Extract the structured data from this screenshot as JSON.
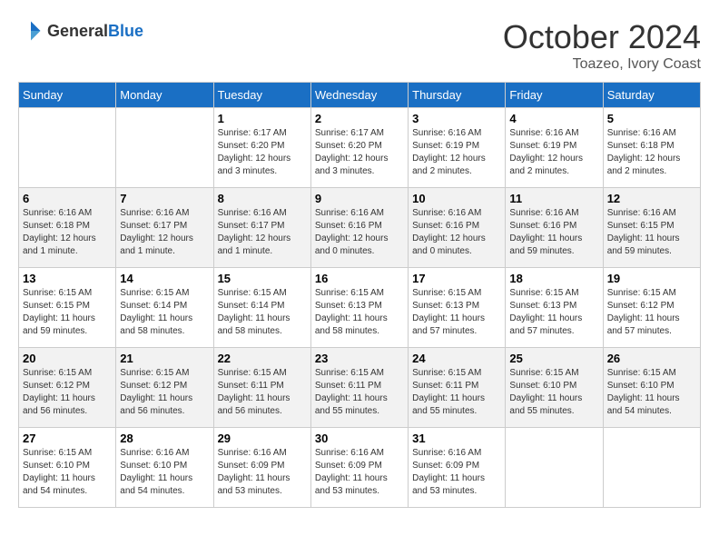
{
  "logo": {
    "text_general": "General",
    "text_blue": "Blue"
  },
  "title": "October 2024",
  "subtitle": "Toazeo, Ivory Coast",
  "days_of_week": [
    "Sunday",
    "Monday",
    "Tuesday",
    "Wednesday",
    "Thursday",
    "Friday",
    "Saturday"
  ],
  "weeks": [
    [
      {
        "day": "",
        "sunrise": "",
        "sunset": "",
        "daylight": ""
      },
      {
        "day": "",
        "sunrise": "",
        "sunset": "",
        "daylight": ""
      },
      {
        "day": "1",
        "sunrise": "Sunrise: 6:17 AM",
        "sunset": "Sunset: 6:20 PM",
        "daylight": "Daylight: 12 hours and 3 minutes."
      },
      {
        "day": "2",
        "sunrise": "Sunrise: 6:17 AM",
        "sunset": "Sunset: 6:20 PM",
        "daylight": "Daylight: 12 hours and 3 minutes."
      },
      {
        "day": "3",
        "sunrise": "Sunrise: 6:16 AM",
        "sunset": "Sunset: 6:19 PM",
        "daylight": "Daylight: 12 hours and 2 minutes."
      },
      {
        "day": "4",
        "sunrise": "Sunrise: 6:16 AM",
        "sunset": "Sunset: 6:19 PM",
        "daylight": "Daylight: 12 hours and 2 minutes."
      },
      {
        "day": "5",
        "sunrise": "Sunrise: 6:16 AM",
        "sunset": "Sunset: 6:18 PM",
        "daylight": "Daylight: 12 hours and 2 minutes."
      }
    ],
    [
      {
        "day": "6",
        "sunrise": "Sunrise: 6:16 AM",
        "sunset": "Sunset: 6:18 PM",
        "daylight": "Daylight: 12 hours and 1 minute."
      },
      {
        "day": "7",
        "sunrise": "Sunrise: 6:16 AM",
        "sunset": "Sunset: 6:17 PM",
        "daylight": "Daylight: 12 hours and 1 minute."
      },
      {
        "day": "8",
        "sunrise": "Sunrise: 6:16 AM",
        "sunset": "Sunset: 6:17 PM",
        "daylight": "Daylight: 12 hours and 1 minute."
      },
      {
        "day": "9",
        "sunrise": "Sunrise: 6:16 AM",
        "sunset": "Sunset: 6:16 PM",
        "daylight": "Daylight: 12 hours and 0 minutes."
      },
      {
        "day": "10",
        "sunrise": "Sunrise: 6:16 AM",
        "sunset": "Sunset: 6:16 PM",
        "daylight": "Daylight: 12 hours and 0 minutes."
      },
      {
        "day": "11",
        "sunrise": "Sunrise: 6:16 AM",
        "sunset": "Sunset: 6:16 PM",
        "daylight": "Daylight: 11 hours and 59 minutes."
      },
      {
        "day": "12",
        "sunrise": "Sunrise: 6:16 AM",
        "sunset": "Sunset: 6:15 PM",
        "daylight": "Daylight: 11 hours and 59 minutes."
      }
    ],
    [
      {
        "day": "13",
        "sunrise": "Sunrise: 6:15 AM",
        "sunset": "Sunset: 6:15 PM",
        "daylight": "Daylight: 11 hours and 59 minutes."
      },
      {
        "day": "14",
        "sunrise": "Sunrise: 6:15 AM",
        "sunset": "Sunset: 6:14 PM",
        "daylight": "Daylight: 11 hours and 58 minutes."
      },
      {
        "day": "15",
        "sunrise": "Sunrise: 6:15 AM",
        "sunset": "Sunset: 6:14 PM",
        "daylight": "Daylight: 11 hours and 58 minutes."
      },
      {
        "day": "16",
        "sunrise": "Sunrise: 6:15 AM",
        "sunset": "Sunset: 6:13 PM",
        "daylight": "Daylight: 11 hours and 58 minutes."
      },
      {
        "day": "17",
        "sunrise": "Sunrise: 6:15 AM",
        "sunset": "Sunset: 6:13 PM",
        "daylight": "Daylight: 11 hours and 57 minutes."
      },
      {
        "day": "18",
        "sunrise": "Sunrise: 6:15 AM",
        "sunset": "Sunset: 6:13 PM",
        "daylight": "Daylight: 11 hours and 57 minutes."
      },
      {
        "day": "19",
        "sunrise": "Sunrise: 6:15 AM",
        "sunset": "Sunset: 6:12 PM",
        "daylight": "Daylight: 11 hours and 57 minutes."
      }
    ],
    [
      {
        "day": "20",
        "sunrise": "Sunrise: 6:15 AM",
        "sunset": "Sunset: 6:12 PM",
        "daylight": "Daylight: 11 hours and 56 minutes."
      },
      {
        "day": "21",
        "sunrise": "Sunrise: 6:15 AM",
        "sunset": "Sunset: 6:12 PM",
        "daylight": "Daylight: 11 hours and 56 minutes."
      },
      {
        "day": "22",
        "sunrise": "Sunrise: 6:15 AM",
        "sunset": "Sunset: 6:11 PM",
        "daylight": "Daylight: 11 hours and 56 minutes."
      },
      {
        "day": "23",
        "sunrise": "Sunrise: 6:15 AM",
        "sunset": "Sunset: 6:11 PM",
        "daylight": "Daylight: 11 hours and 55 minutes."
      },
      {
        "day": "24",
        "sunrise": "Sunrise: 6:15 AM",
        "sunset": "Sunset: 6:11 PM",
        "daylight": "Daylight: 11 hours and 55 minutes."
      },
      {
        "day": "25",
        "sunrise": "Sunrise: 6:15 AM",
        "sunset": "Sunset: 6:10 PM",
        "daylight": "Daylight: 11 hours and 55 minutes."
      },
      {
        "day": "26",
        "sunrise": "Sunrise: 6:15 AM",
        "sunset": "Sunset: 6:10 PM",
        "daylight": "Daylight: 11 hours and 54 minutes."
      }
    ],
    [
      {
        "day": "27",
        "sunrise": "Sunrise: 6:15 AM",
        "sunset": "Sunset: 6:10 PM",
        "daylight": "Daylight: 11 hours and 54 minutes."
      },
      {
        "day": "28",
        "sunrise": "Sunrise: 6:16 AM",
        "sunset": "Sunset: 6:10 PM",
        "daylight": "Daylight: 11 hours and 54 minutes."
      },
      {
        "day": "29",
        "sunrise": "Sunrise: 6:16 AM",
        "sunset": "Sunset: 6:09 PM",
        "daylight": "Daylight: 11 hours and 53 minutes."
      },
      {
        "day": "30",
        "sunrise": "Sunrise: 6:16 AM",
        "sunset": "Sunset: 6:09 PM",
        "daylight": "Daylight: 11 hours and 53 minutes."
      },
      {
        "day": "31",
        "sunrise": "Sunrise: 6:16 AM",
        "sunset": "Sunset: 6:09 PM",
        "daylight": "Daylight: 11 hours and 53 minutes."
      },
      {
        "day": "",
        "sunrise": "",
        "sunset": "",
        "daylight": ""
      },
      {
        "day": "",
        "sunrise": "",
        "sunset": "",
        "daylight": ""
      }
    ]
  ]
}
